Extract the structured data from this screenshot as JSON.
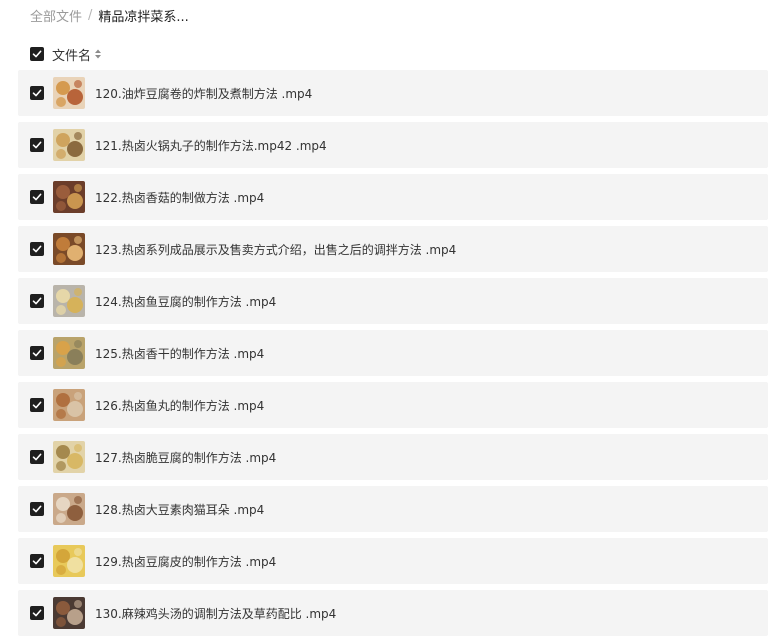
{
  "breadcrumb": {
    "root": "全部文件",
    "separator": "/",
    "current": "精品凉拌菜系..."
  },
  "list_header": {
    "label": "文件名",
    "select_all_checked": true,
    "sort_icon": "sort-icon"
  },
  "files": [
    {
      "name": "120.油炸豆腐卷的炸制及煮制方法 .mp4",
      "checked": true,
      "thumb_colors": [
        "#e9d3b8",
        "#d59a4f",
        "#b8643a"
      ]
    },
    {
      "name": "121.热卤火锅丸子的制作方法.mp42 .mp4",
      "checked": true,
      "thumb_colors": [
        "#e2d2a8",
        "#cfa45e",
        "#8b6a3f"
      ]
    },
    {
      "name": "122.热卤香菇的制做方法 .mp4",
      "checked": true,
      "thumb_colors": [
        "#6b3d2a",
        "#9a5d3c",
        "#c9954f"
      ]
    },
    {
      "name": "123.热卤系列成品展示及售卖方式介绍，出售之后的调拌方法 .mp4",
      "checked": true,
      "thumb_colors": [
        "#7a4a28",
        "#c07c3a",
        "#e0b070"
      ]
    },
    {
      "name": "124.热卤鱼豆腐的制作方法 .mp4",
      "checked": true,
      "thumb_colors": [
        "#b9b4aa",
        "#e6d7a8",
        "#d6b25a"
      ]
    },
    {
      "name": "125.热卤香干的制作方法 .mp4",
      "checked": true,
      "thumb_colors": [
        "#b9a36a",
        "#d8a24a",
        "#8a7f5a"
      ]
    },
    {
      "name": "126.热卤鱼丸的制作方法 .mp4",
      "checked": true,
      "thumb_colors": [
        "#c9a27a",
        "#b0703f",
        "#d9c3a6"
      ]
    },
    {
      "name": "127.热卤脆豆腐的制作方法 .mp4",
      "checked": true,
      "thumb_colors": [
        "#e2d3a8",
        "#a5894e",
        "#d8b865"
      ]
    },
    {
      "name": "128.热卤大豆素肉猫耳朵 .mp4",
      "checked": true,
      "thumb_colors": [
        "#caa98a",
        "#e6d6c2",
        "#8e5f3e"
      ]
    },
    {
      "name": "129.热卤豆腐皮的制作方法 .mp4",
      "checked": true,
      "thumb_colors": [
        "#e8c95a",
        "#d4a63a",
        "#f0e0a0"
      ]
    },
    {
      "name": "130.麻辣鸡头汤的调制方法及草药配比 .mp4",
      "checked": true,
      "thumb_colors": [
        "#4b3a33",
        "#8a5a3c",
        "#b8a08a"
      ]
    }
  ],
  "colors": {
    "row_background": "#f4f4f4",
    "checkbox_fill": "#1f1f1f",
    "breadcrumb_muted": "#9a9a9a"
  }
}
